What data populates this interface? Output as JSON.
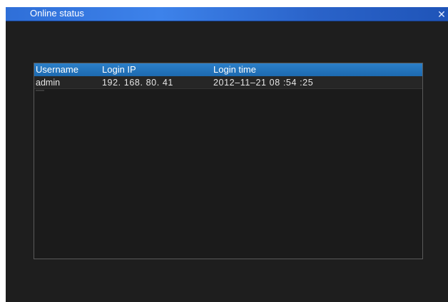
{
  "window": {
    "title": "Online status",
    "close_icon": "close-icon"
  },
  "table": {
    "columns": [
      "Username",
      "Login IP",
      "Login time"
    ],
    "rows": [
      {
        "username": "admin",
        "login_ip": "192. 168. 80. 41",
        "login_time": "2012–11–21  08 :54 :25"
      }
    ]
  },
  "colors": {
    "titlebar": "#3d82ea",
    "header": "#2b7fc9",
    "background": "#1e1e1e"
  }
}
